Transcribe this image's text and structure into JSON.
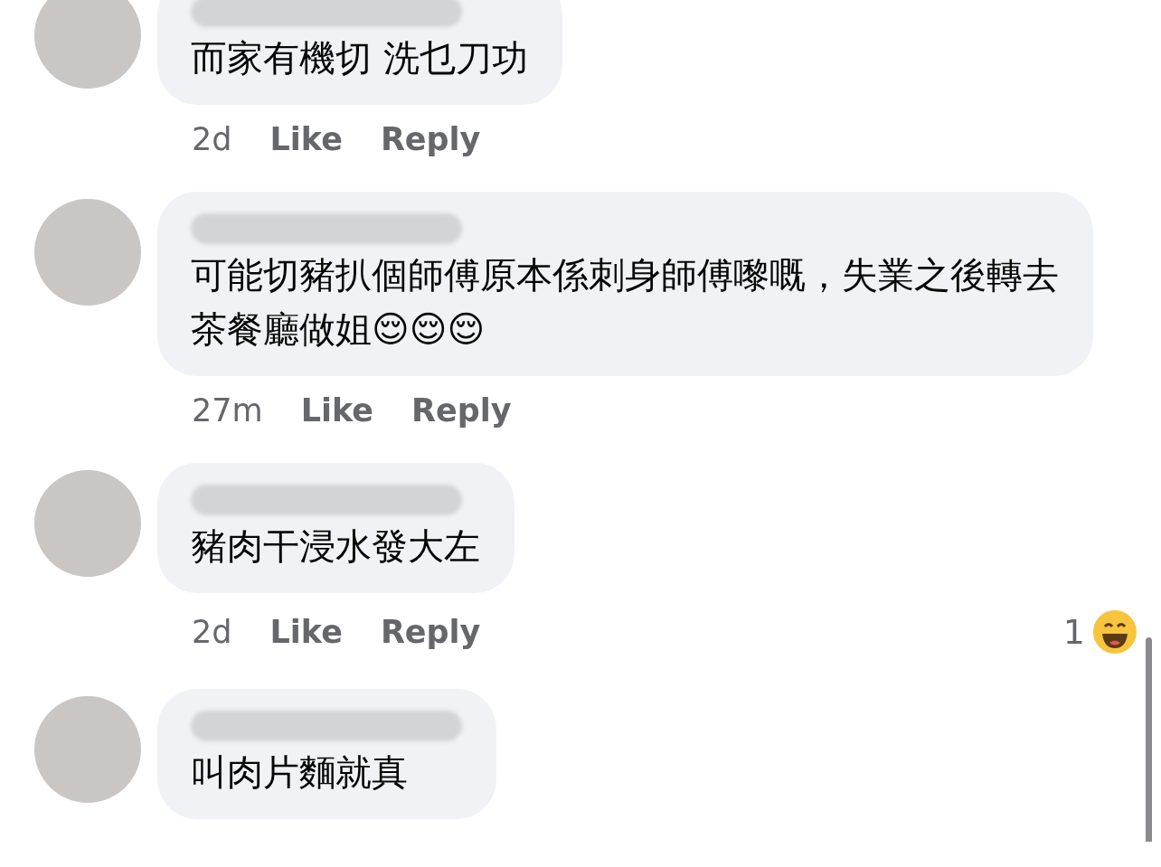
{
  "comments": [
    {
      "text": "而家有機切 洗乜刀功",
      "time": "2d",
      "like": "Like",
      "reply": "Reply"
    },
    {
      "text": "可能切豬扒個師傅原本係刺身師傅嚟嘅，失業之後轉去茶餐廳做姐😌😌😌",
      "time": "27m",
      "like": "Like",
      "reply": "Reply"
    },
    {
      "text": "豬肉干浸水發大左",
      "time": "2d",
      "like": "Like",
      "reply": "Reply",
      "reactions": {
        "count": "1"
      }
    },
    {
      "text": "叫肉片麵就真"
    }
  ]
}
